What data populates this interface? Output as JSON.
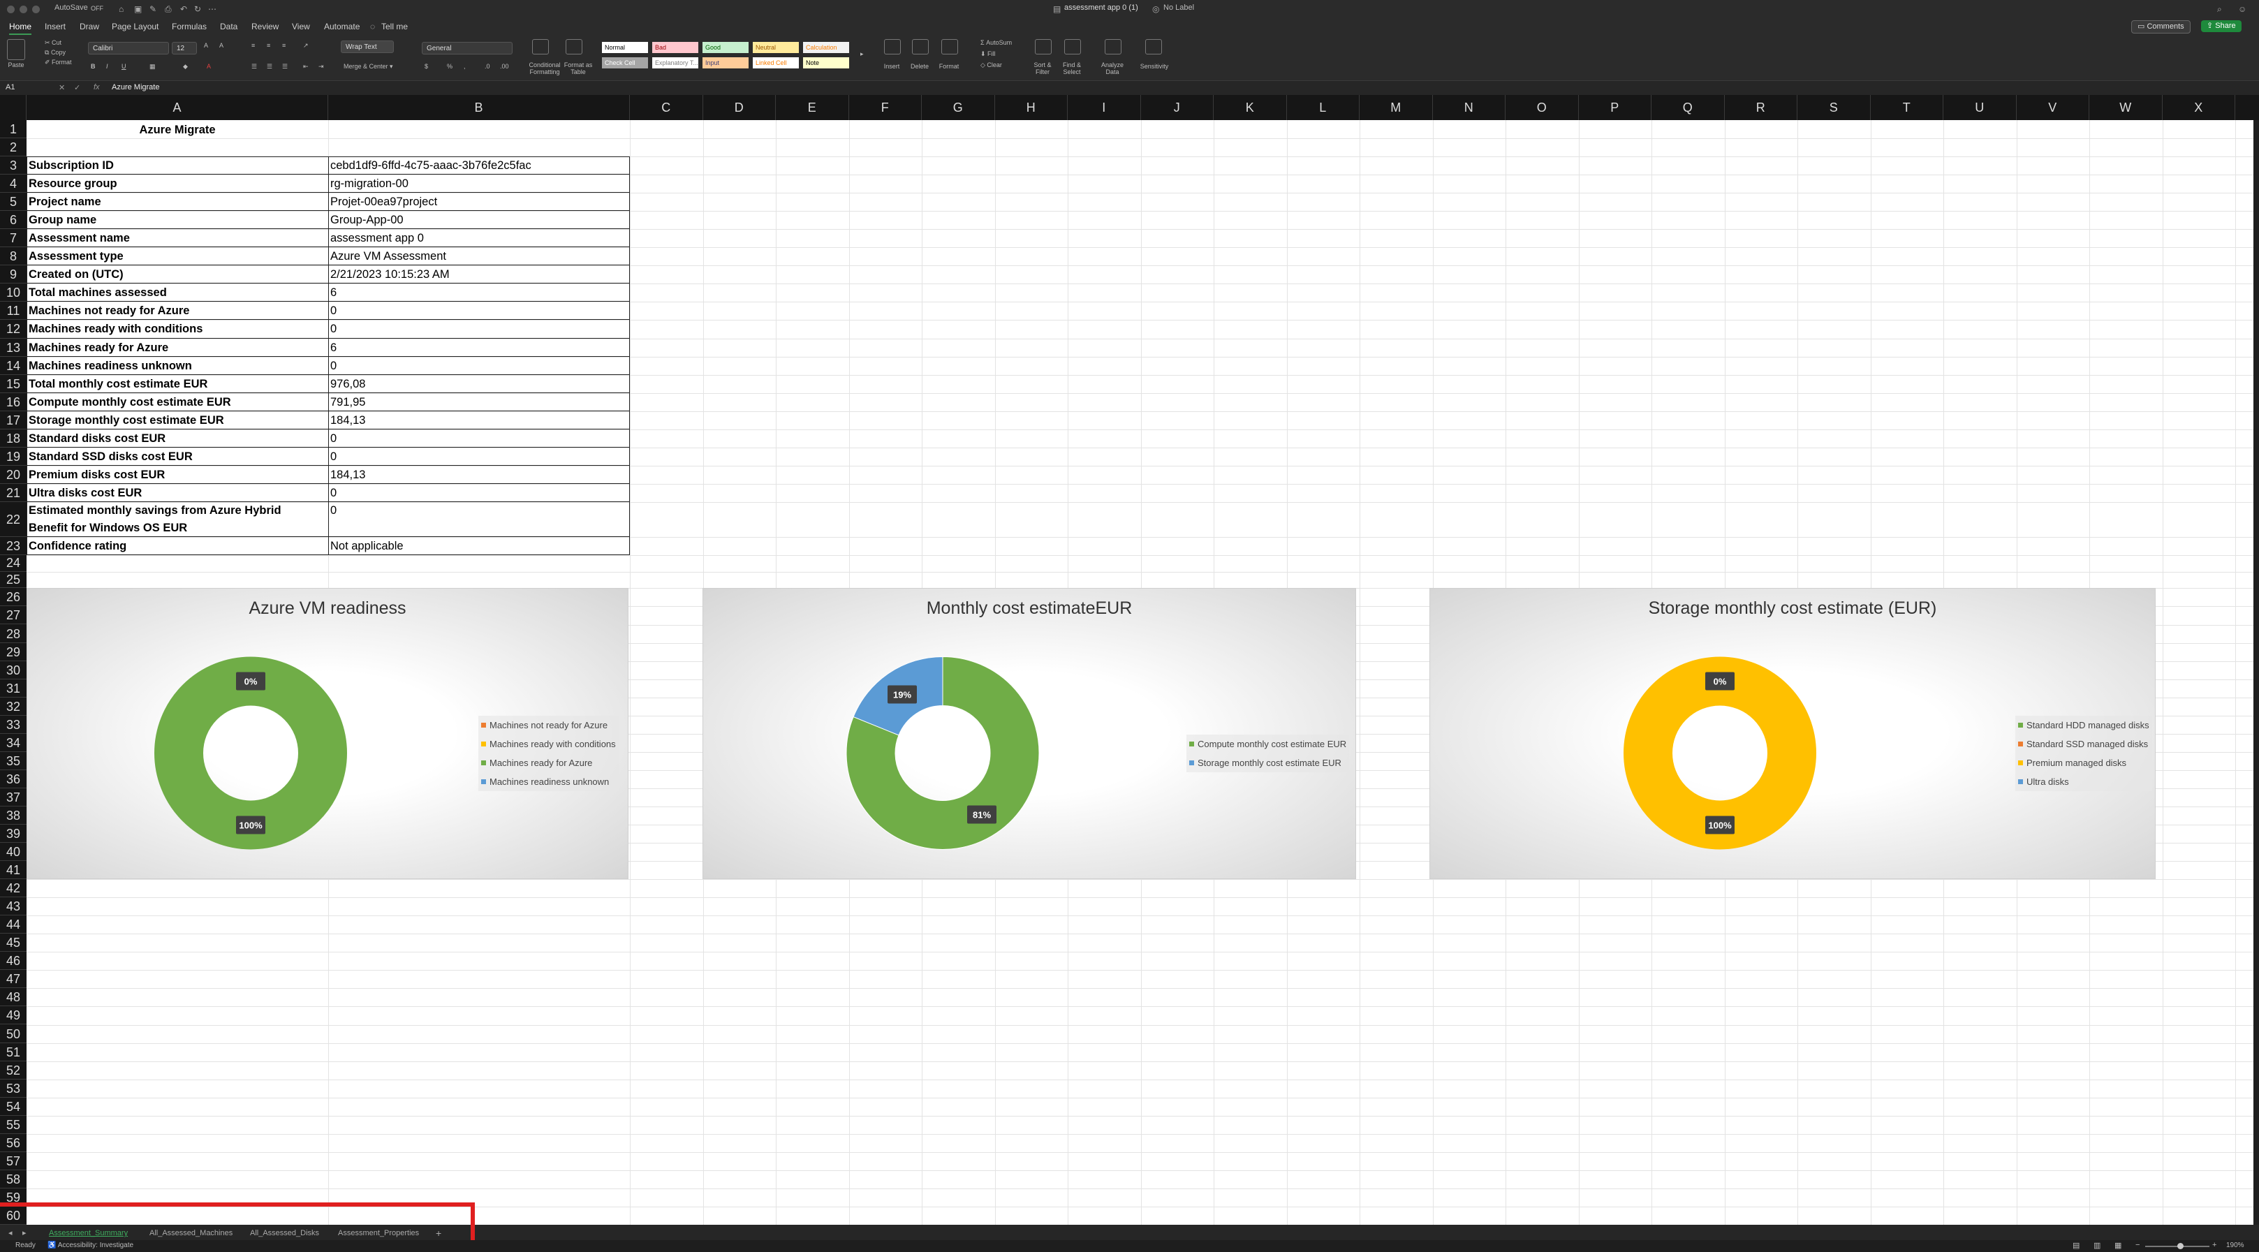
{
  "window": {
    "title": "assessment app 0 (1)",
    "label": "No Label",
    "autosave": "AutoSave",
    "autosave_state": "OFF"
  },
  "menu": [
    "Home",
    "Insert",
    "Draw",
    "Page Layout",
    "Formulas",
    "Data",
    "Review",
    "View",
    "Automate",
    "Tell me"
  ],
  "menu_buttons": {
    "comments": "Comments",
    "share": "Share"
  },
  "ribbon": {
    "paste": "Paste",
    "cut": "Cut",
    "copy": "Copy",
    "format": "Format",
    "font_name": "Calibri",
    "font_size": "12",
    "wrap_text": "Wrap Text",
    "merge_center": "Merge & Center",
    "number_format": "General",
    "conditional_formatting": "Conditional Formatting",
    "format_as_table": "Format as Table",
    "styles": [
      {
        "label": "Normal",
        "bg": "#ffffff",
        "fg": "#000000"
      },
      {
        "label": "Bad",
        "bg": "#ffc7ce",
        "fg": "#9c0006"
      },
      {
        "label": "Good",
        "bg": "#c6efce",
        "fg": "#006100"
      },
      {
        "label": "Neutral",
        "bg": "#ffeb9c",
        "fg": "#9c5700"
      },
      {
        "label": "Calculation",
        "bg": "#f2f2f2",
        "fg": "#fa7d00"
      },
      {
        "label": "Check Cell",
        "bg": "#a5a5a5",
        "fg": "#ffffff"
      },
      {
        "label": "Explanatory T...",
        "bg": "#ffffff",
        "fg": "#7f7f7f"
      },
      {
        "label": "Input",
        "bg": "#ffcc99",
        "fg": "#3f3f76"
      },
      {
        "label": "Linked Cell",
        "bg": "#ffffff",
        "fg": "#fa7d00"
      },
      {
        "label": "Note",
        "bg": "#ffffcc",
        "fg": "#000000"
      }
    ],
    "insert": "Insert",
    "delete": "Delete",
    "format_cells": "Format",
    "autosum": "AutoSum",
    "fill": "Fill",
    "clear": "Clear",
    "sort_filter": "Sort & Filter",
    "find_select": "Find & Select",
    "analyze_data": "Analyze Data",
    "sensitivity": "Sensitivity"
  },
  "formula_bar": {
    "name_box": "A1",
    "fx": "fx",
    "content": "Azure Migrate"
  },
  "columns": [
    "A",
    "B",
    "C",
    "D",
    "E",
    "F",
    "G",
    "H",
    "I",
    "J",
    "K",
    "L",
    "M",
    "N",
    "O",
    "P",
    "Q",
    "R",
    "S",
    "T",
    "U",
    "V",
    "W",
    "X"
  ],
  "sheet": {
    "title": "Azure Migrate",
    "rows": [
      {
        "label": "Subscription ID",
        "value": "cebd1df9-6ffd-4c75-aaac-3b76fe2c5fac"
      },
      {
        "label": "Resource group",
        "value": "rg-migration-00"
      },
      {
        "label": "Project name",
        "value": "Projet-00ea97project"
      },
      {
        "label": "Group name",
        "value": "Group-App-00"
      },
      {
        "label": "Assessment name",
        "value": "assessment app 0"
      },
      {
        "label": "Assessment type",
        "value": "Azure VM Assessment"
      },
      {
        "label": "Created on (UTC)",
        "value": "2/21/2023 10:15:23 AM"
      },
      {
        "label": "Total machines assessed",
        "value": "6"
      },
      {
        "label": "Machines not ready for Azure",
        "value": "0"
      },
      {
        "label": "Machines ready with conditions",
        "value": "0"
      },
      {
        "label": "Machines ready for Azure",
        "value": "6"
      },
      {
        "label": "Machines readiness unknown",
        "value": "0"
      },
      {
        "label": "Total monthly cost estimate EUR",
        "value": "976,08"
      },
      {
        "label": "Compute monthly cost estimate EUR",
        "value": "791,95"
      },
      {
        "label": "Storage monthly cost estimate EUR",
        "value": "184,13"
      },
      {
        "label": "Standard disks cost EUR",
        "value": "0"
      },
      {
        "label": "Standard SSD disks cost EUR",
        "value": "0"
      },
      {
        "label": "Premium disks cost EUR",
        "value": "184,13"
      },
      {
        "label": "Ultra disks cost EUR",
        "value": "0"
      },
      {
        "label": "Estimated monthly savings from Azure Hybrid",
        "label2": "Benefit for Windows OS EUR",
        "value": "0"
      },
      {
        "label": "Confidence rating",
        "value": "Not applicable"
      }
    ]
  },
  "charts": [
    {
      "title": "Azure VM readiness",
      "legend": [
        {
          "name": "Machines not ready for Azure",
          "color": "#ed7d31"
        },
        {
          "name": "Machines ready with conditions",
          "color": "#ffc000"
        },
        {
          "name": "Machines ready for Azure",
          "color": "#70ad47"
        },
        {
          "name": "Machines readiness unknown",
          "color": "#5b9bd5"
        }
      ],
      "values": [
        0,
        0,
        6,
        0
      ],
      "labels": [
        "0%",
        "100%"
      ]
    },
    {
      "title": "Monthly cost estimateEUR",
      "legend": [
        {
          "name": "Compute monthly cost estimate EUR",
          "color": "#70ad47"
        },
        {
          "name": "Storage monthly cost estimate EUR",
          "color": "#5b9bd5"
        }
      ],
      "values": [
        791.95,
        184.13
      ],
      "labels": [
        "19%",
        "81%"
      ]
    },
    {
      "title": "Storage monthly cost estimate (EUR)",
      "legend": [
        {
          "name": "Standard HDD managed disks",
          "color": "#70ad47"
        },
        {
          "name": "Standard SSD managed disks",
          "color": "#ed7d31"
        },
        {
          "name": "Premium managed disks",
          "color": "#ffc000"
        },
        {
          "name": "Ultra disks",
          "color": "#5b9bd5"
        }
      ],
      "values": [
        0,
        0,
        184.13,
        0
      ],
      "labels": [
        "0%",
        "100%"
      ]
    }
  ],
  "tabs": [
    "Assessment_Summary",
    "All_Assessed_Machines",
    "All_Assessed_Disks",
    "Assessment_Properties"
  ],
  "status": {
    "ready": "Ready",
    "accessibility": "Accessibility: Investigate",
    "zoom": "190%"
  }
}
